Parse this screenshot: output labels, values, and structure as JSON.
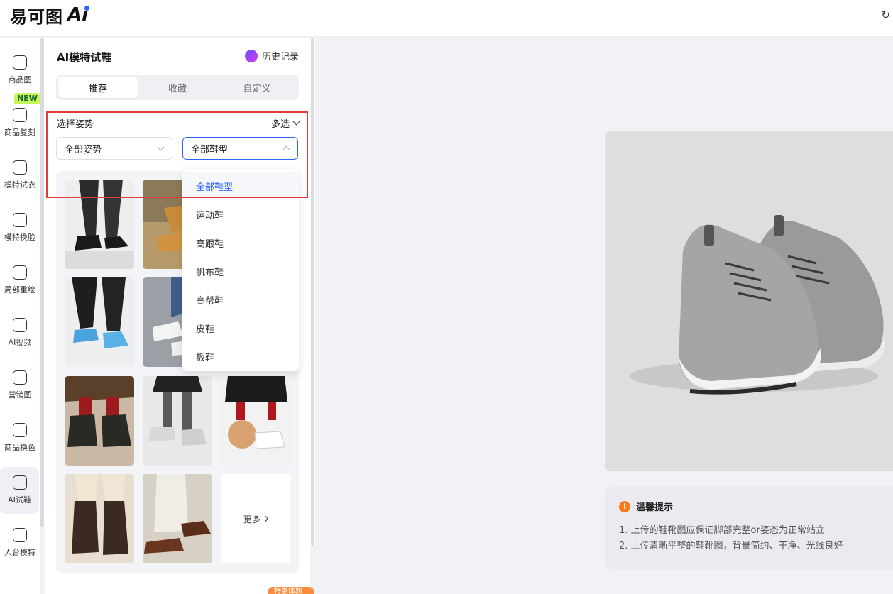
{
  "app": {
    "logo_text": "易可图",
    "logo_ai": "Ai"
  },
  "nav": {
    "new_badge": "NEW",
    "items": [
      {
        "label": "商品图",
        "icon": "bag-icon"
      },
      {
        "label": "商品复刻",
        "icon": "bag-copy-icon"
      },
      {
        "label": "模特试衣",
        "icon": "shirt-icon"
      },
      {
        "label": "模特换脸",
        "icon": "face-icon"
      },
      {
        "label": "局部重绘",
        "icon": "repaint-icon"
      },
      {
        "label": "AI视频",
        "icon": "video-icon"
      },
      {
        "label": "营销图",
        "icon": "marketing-icon"
      },
      {
        "label": "商品换色",
        "icon": "color-drop-icon"
      },
      {
        "label": "AI试鞋",
        "icon": "shoe-icon"
      },
      {
        "label": "人台模特",
        "icon": "mannequin-icon"
      }
    ]
  },
  "panel": {
    "title": "AI模特试鞋",
    "history_label": "历史记录",
    "tabs": [
      {
        "label": "推荐",
        "active": true
      },
      {
        "label": "收藏",
        "active": false
      },
      {
        "label": "自定义",
        "active": false
      }
    ],
    "filter_label": "选择姿势",
    "multi_label": "多选",
    "pose_select": "全部姿势",
    "shoe_select": "全部鞋型",
    "more_label": "更多",
    "dropdown_options": [
      "全部鞋型",
      "运动鞋",
      "高跟鞋",
      "帆布鞋",
      "高帮鞋",
      "皮鞋",
      "板鞋"
    ],
    "dropdown_selected": "全部鞋型",
    "bottom_tag": "特惠体验"
  },
  "tips": {
    "title": "温馨提示",
    "lines": [
      "1. 上传的鞋靴图应保证脚部完整or姿态为正常站立",
      "2. 上传清晰平整的鞋靴图，背景简约、干净、光线良好"
    ]
  },
  "colors": {
    "accent": "#2c63ff",
    "highlight_box": "#e53935",
    "new_badge": "#c9f75b",
    "warning": "#ff7a1a"
  }
}
